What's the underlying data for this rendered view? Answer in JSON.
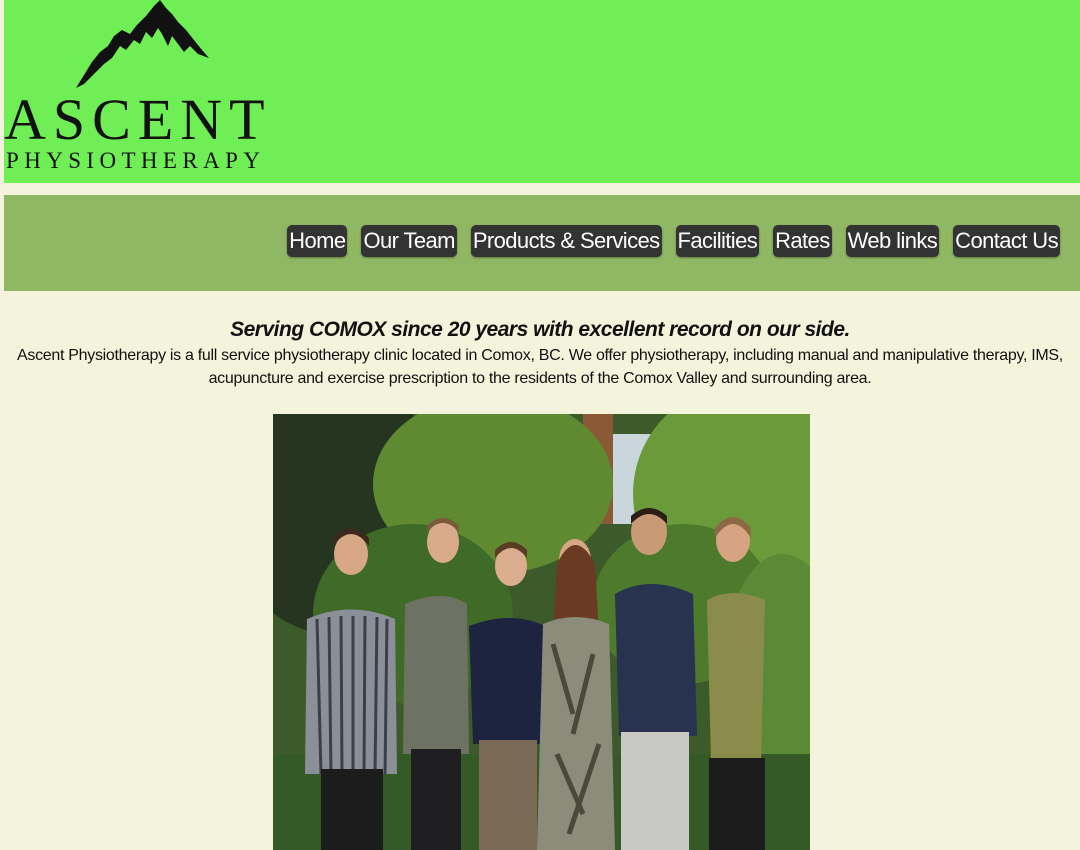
{
  "header": {
    "logo": {
      "title": "ASCENT",
      "subtitle": "PHYSIOTHERAPY",
      "icon": "mountain-icon"
    }
  },
  "nav": {
    "items": [
      {
        "label": "Home"
      },
      {
        "label": "Our Team"
      },
      {
        "label": "Products & Services"
      },
      {
        "label": "Facilities"
      },
      {
        "label": "Rates"
      },
      {
        "label": "Web links"
      },
      {
        "label": "Contact Us"
      }
    ]
  },
  "main": {
    "tagline": "Serving COMOX since 20 years with excellent record on our side.",
    "intro": "Ascent Physiotherapy is a full service physiotherapy clinic located in Comox, BC. We offer physiotherapy, including manual and manipulative therapy, IMS, acupuncture and exercise prescription to the residents of the Comox Valley and surrounding area."
  },
  "colors": {
    "header_bg": "#6fee55",
    "nav_bg": "#90b864",
    "page_bg": "#f4f4dc",
    "nav_button_bg": "#333333"
  }
}
